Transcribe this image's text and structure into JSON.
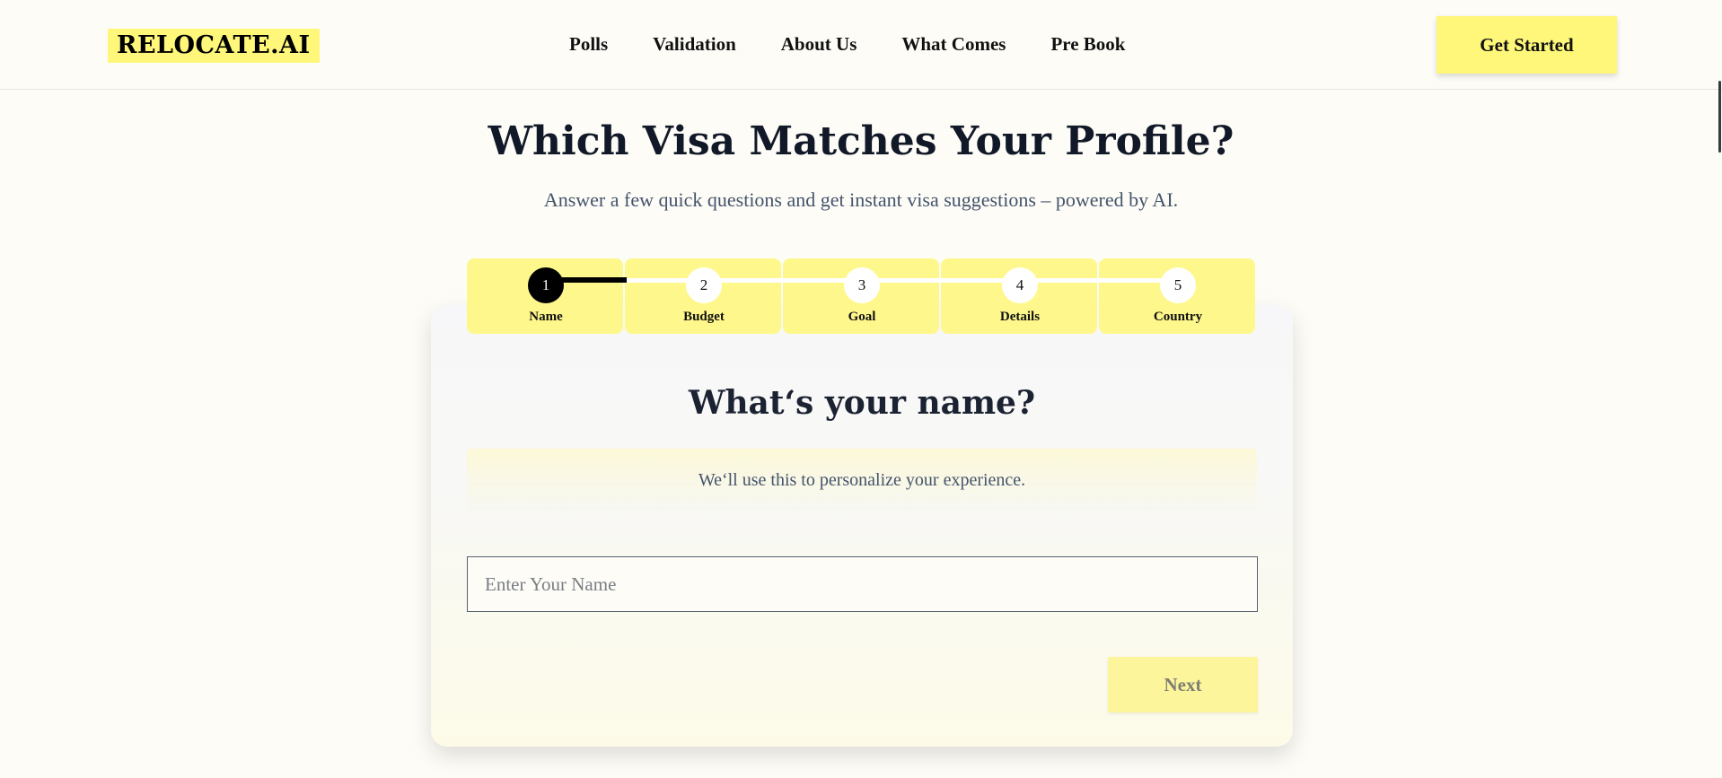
{
  "header": {
    "logo": "RELOCATE.AI",
    "nav": [
      {
        "label": "Polls"
      },
      {
        "label": "Validation"
      },
      {
        "label": "About Us"
      },
      {
        "label": "What Comes"
      },
      {
        "label": "Pre Book"
      }
    ],
    "cta_label": "Get Started"
  },
  "hero": {
    "title": "Which Visa Matches Your Profile?",
    "subtitle": "Answer a few quick questions and get instant visa suggestions – powered by AI."
  },
  "stepper": {
    "current_step": 1,
    "steps": [
      {
        "number": "1",
        "label": "Name"
      },
      {
        "number": "2",
        "label": "Budget"
      },
      {
        "number": "3",
        "label": "Goal"
      },
      {
        "number": "4",
        "label": "Details"
      },
      {
        "number": "5",
        "label": "Country"
      }
    ]
  },
  "form": {
    "question": "What‘s your name?",
    "hint": "We‘ll use this to personalize your experience.",
    "input_placeholder": "Enter Your Name",
    "input_value": "",
    "next_label": "Next"
  },
  "colors": {
    "accent": "#fef77a",
    "step_bg": "#fef88c",
    "active_step": "#000000",
    "text_dark": "#111827",
    "text_muted": "#44546b"
  }
}
